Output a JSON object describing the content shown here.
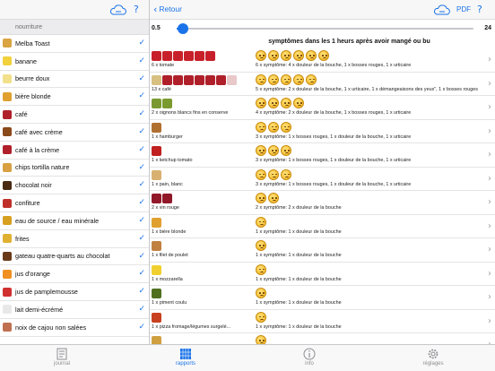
{
  "colors": {
    "accent": "#1a73e8",
    "tab_inactive": "#8e8e93"
  },
  "left": {
    "help_label": "?",
    "section_header": "nourriture",
    "items": [
      {
        "label": "Melba Toast",
        "color": "#d9a441",
        "icon": "toast-icon"
      },
      {
        "label": "banane",
        "color": "#f2d13c",
        "icon": "banana-icon"
      },
      {
        "label": "beurre doux",
        "color": "#f3e08a",
        "icon": "butter-icon"
      },
      {
        "label": "bière blonde",
        "color": "#e0a030",
        "icon": "beer-icon"
      },
      {
        "label": "café",
        "color": "#b0202a",
        "icon": "coffee-icon"
      },
      {
        "label": "café avec crème",
        "color": "#8a4a1a",
        "icon": "coffee-cream-icon"
      },
      {
        "label": "café à la crème",
        "color": "#b0202a",
        "icon": "coffee-cream-icon"
      },
      {
        "label": "chips tortilla nature",
        "color": "#d8a040",
        "icon": "chips-icon"
      },
      {
        "label": "chocolat noir",
        "color": "#4a2a12",
        "icon": "chocolate-icon"
      },
      {
        "label": "confiture",
        "color": "#c0302a",
        "icon": "jam-icon"
      },
      {
        "label": "eau de source / eau minérale",
        "color": "#d8a020",
        "icon": "water-icon"
      },
      {
        "label": "frites",
        "color": "#e0b030",
        "icon": "fries-icon"
      },
      {
        "label": "gateau quatre-quarts au chocolat",
        "color": "#6a3a18",
        "icon": "cake-icon"
      },
      {
        "label": "jus d'orange",
        "color": "#f09020",
        "icon": "orange-juice-icon"
      },
      {
        "label": "jus de pamplemousse",
        "color": "#d03030",
        "icon": "grapefruit-juice-icon"
      },
      {
        "label": "lait demi-écrémé",
        "color": "#e8e8e8",
        "icon": "milk-icon"
      },
      {
        "label": "noix de cajou non salées",
        "color": "#c07050",
        "icon": "cashew-icon"
      }
    ],
    "check_mark": "✓"
  },
  "nav": {
    "back_label": "Retour",
    "pdf_label": "PDF",
    "help_label": "?"
  },
  "slider": {
    "min_label": "0.5",
    "max_label": "24",
    "min": 0.5,
    "max": 24,
    "value": 1
  },
  "results_title": "symptômes dans les 1 heurs après avoir mangé ou bu",
  "rows": [
    {
      "food_text": "6 x tomate",
      "symptom_text": "6 x symptôme: 4 x douleur de la bouche, 1 x bosses rouges, 1 x urticaire",
      "food_icons": [
        "#c8202a",
        "#c8202a",
        "#c8202a",
        "#c8202a",
        "#c8202a",
        "#c8202a"
      ],
      "faces": 6
    },
    {
      "food_text": "13 x café",
      "symptom_text": "5 x symptôme: 2 x douleur de la bouche, 1 x urticaire, 1 x démangeaisons des yeux\", 1 x bosses rouges",
      "food_icons": [
        "#d8c080",
        "#b0202a",
        "#b0202a",
        "#b0202a",
        "#b0202a",
        "#b0202a",
        "#b0202a",
        "#e8c8c8"
      ],
      "faces": 5
    },
    {
      "food_text": "2 x oignons blancs fins en conserve",
      "symptom_text": "4 x symptôme: 2 x douleur de la bouche, 1 x bosses rouges, 1 x urticaire",
      "food_icons": [
        "#7a9a30",
        "#7a9a30"
      ],
      "faces": 4
    },
    {
      "food_text": "1 x hamburger",
      "symptom_text": "3 x symptôme: 1 x bosses rouges, 1 x douleur de la bouche, 1 x urticaire",
      "food_icons": [
        "#b07030"
      ],
      "faces": 3
    },
    {
      "food_text": "1 x ketchup tomato",
      "symptom_text": "3 x symptôme: 1 x bosses rouges, 1 x douleur de la bouche, 1 x urticaire",
      "food_icons": [
        "#c02020"
      ],
      "faces": 3
    },
    {
      "food_text": "1 x pain, blanc",
      "symptom_text": "3 x symptôme: 1 x bosses rouges, 1 x douleur de la bouche, 1 x urticaire",
      "food_icons": [
        "#d8b070"
      ],
      "faces": 3
    },
    {
      "food_text": "2 x vin rouge",
      "symptom_text": "2 x symptôme: 2 x douleur de la bouche",
      "food_icons": [
        "#901828",
        "#901828"
      ],
      "faces": 2
    },
    {
      "food_text": "1 x bière blonde",
      "symptom_text": "1 x symptôme: 1 x douleur de la bouche",
      "food_icons": [
        "#e0a030"
      ],
      "faces": 1
    },
    {
      "food_text": "1 x filet de poulet",
      "symptom_text": "1 x symptôme: 1 x douleur de la bouche",
      "food_icons": [
        "#c08040"
      ],
      "faces": 1
    },
    {
      "food_text": "1 x mozzarella",
      "symptom_text": "1 x symptôme: 1 x douleur de la bouche",
      "food_icons": [
        "#f0d030"
      ],
      "faces": 1
    },
    {
      "food_text": "1 x piment coulu",
      "symptom_text": "1 x symptôme: 1 x douleur de la bouche",
      "food_icons": [
        "#507020"
      ],
      "faces": 1
    },
    {
      "food_text": "1 x pizza fromage/légumes surgelé...",
      "symptom_text": "1 x symptôme: 1 x douleur de la bouche",
      "food_icons": [
        "#c84020"
      ],
      "faces": 1
    },
    {
      "food_text": "",
      "symptom_text": "",
      "food_icons": [
        "#d0a040"
      ],
      "faces": 1
    }
  ],
  "row_chevron": "›",
  "tabs": [
    {
      "label": "journal",
      "icon": "journal-icon",
      "active": false
    },
    {
      "label": "rapports",
      "icon": "reports-icon",
      "active": true
    },
    {
      "label": "info",
      "icon": "info-icon",
      "active": false
    },
    {
      "label": "réglages",
      "icon": "settings-icon",
      "active": false
    }
  ]
}
